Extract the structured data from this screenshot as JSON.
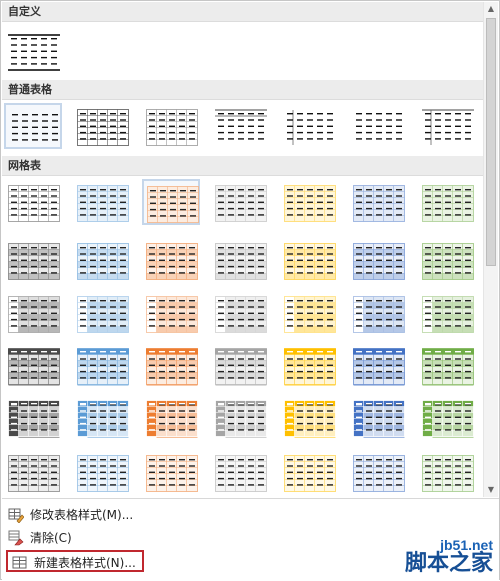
{
  "sections": {
    "custom": "自定义",
    "plain": "普通表格",
    "grid": "网格表"
  },
  "menu": {
    "modify": "修改表格样式(M)...",
    "clear": "清除(C)",
    "new": "新建表格样式(N)..."
  },
  "watermark": {
    "top": "jb51.net",
    "bottom": "脚本之家"
  },
  "grid_column_colors": [
    "#4a4a4a",
    "#5b9bd5",
    "#ed7d31",
    "#a5a5a5",
    "#ffc000",
    "#4472c4",
    "#70ad47"
  ],
  "grid_style_rows": [
    "grid-light",
    "grid-2",
    "grid-3",
    "grid-4",
    "grid-5",
    "grid-6"
  ],
  "plain_styles": [
    "table-grid",
    "table-grid-light",
    "plain-1",
    "plain-2",
    "plain-3",
    "plain-4",
    "plain-5"
  ],
  "icons": {
    "modify": "table-edit-icon",
    "clear": "eraser-icon",
    "new": "new-table-icon"
  }
}
